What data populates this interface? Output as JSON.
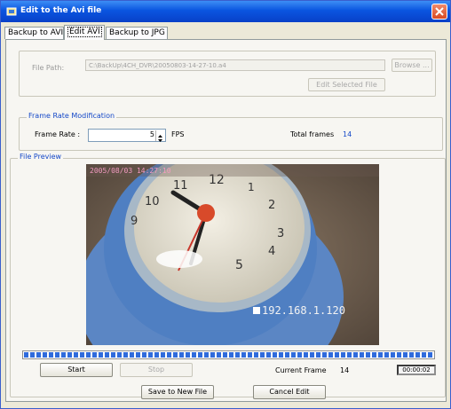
{
  "window": {
    "title": "Edit to the Avi file",
    "close_icon": "close-icon"
  },
  "tabs": [
    {
      "label": "Backup to AVI",
      "active": false
    },
    {
      "label": "Edit AVI",
      "active": true
    },
    {
      "label": "Backup to JPG",
      "active": false
    }
  ],
  "file_section": {
    "path_label": "File Path:",
    "path_value": "C:\\BackUp\\4CH_DVR\\20050803-14-27-10.a4",
    "browse_label": "Browse ...",
    "edit_selected_label": "Edit Selected File"
  },
  "frame_rate": {
    "group_title": "Frame Rate Modification",
    "label": "Frame Rate :",
    "value": "5",
    "unit": "FPS",
    "total_label": "Total frames",
    "total_value": "14"
  },
  "preview": {
    "group_title": "File Preview",
    "overlay_datetime": "2005/08/03 14:27:10",
    "overlay_ip": "192.168.1.120",
    "clock_numbers": [
      "12",
      "1",
      "2",
      "3",
      "4",
      "5",
      "9",
      "10",
      "11"
    ],
    "progress": 1.0,
    "start_label": "Start",
    "stop_label": "Stop",
    "current_frame_label": "Current Frame",
    "current_frame_value": "14",
    "time_display": "00:00:02"
  },
  "bottom": {
    "save_label": "Save to New File",
    "cancel_label": "Cancel Edit"
  },
  "colors": {
    "titlebar": "#0a55e0",
    "group_title": "#1448c8",
    "progress": "#2f6bdc",
    "close": "#d84a22"
  }
}
